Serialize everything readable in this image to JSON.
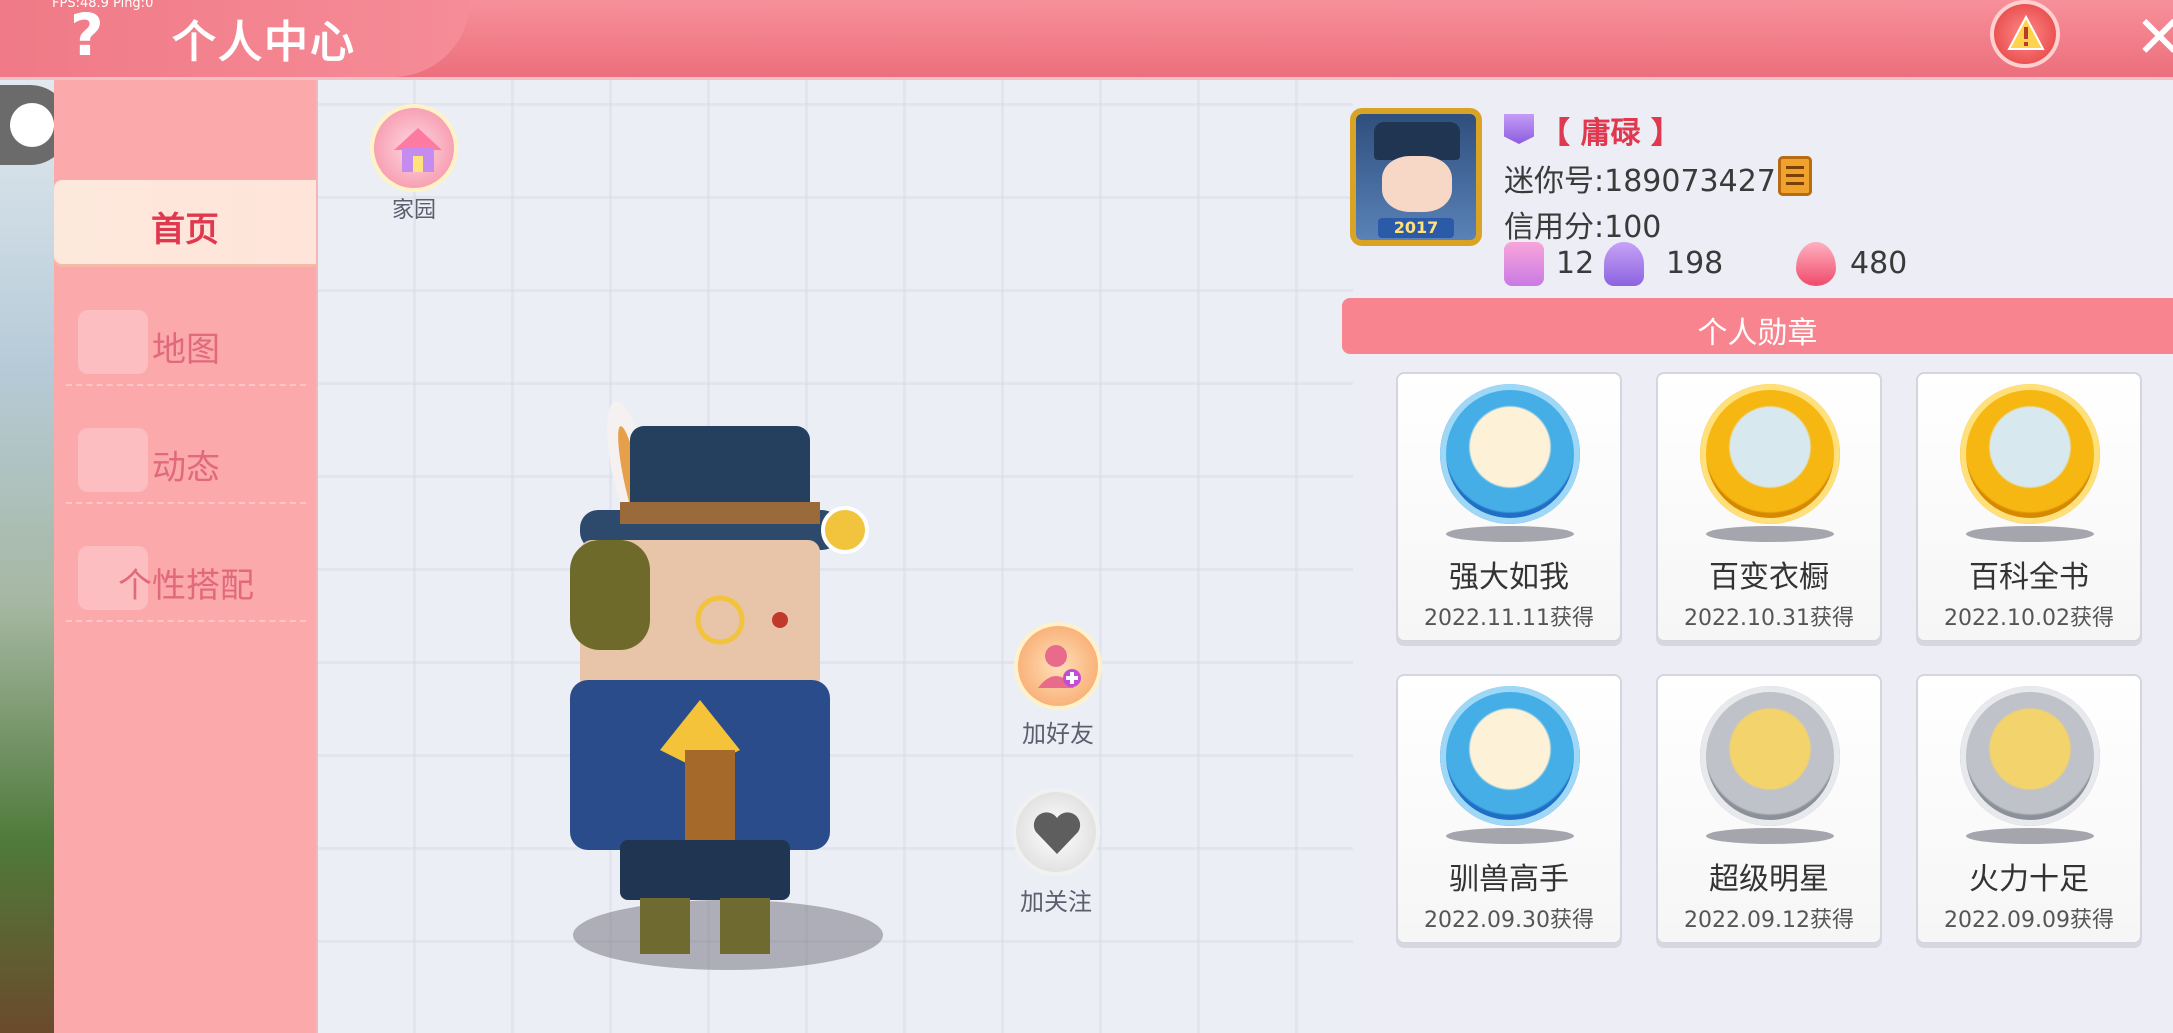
{
  "header": {
    "fps": "FPS:48.9 Ping:0",
    "help_label": "?",
    "title": "个人中心",
    "close_label": "✕",
    "warning_icon": "warning-icon"
  },
  "sidebar": {
    "items": [
      {
        "label": "首页",
        "active": true
      },
      {
        "label": "地图",
        "active": false
      },
      {
        "label": "动态",
        "active": false
      },
      {
        "label": "个性搭配",
        "active": false
      }
    ]
  },
  "main": {
    "home_label": "家园",
    "add_friend_label": "加好友",
    "follow_label": "加关注"
  },
  "profile": {
    "portrait_year": "2017",
    "nickname": "【 庸碌 】",
    "mini_id": "迷你号:189073427",
    "credit": "信用分:100",
    "stats": [
      "12",
      "198",
      "480"
    ]
  },
  "medals": {
    "header": "个人勋章",
    "items": [
      {
        "name": "强大如我",
        "date": "2022.11.11获得",
        "tier": "blue"
      },
      {
        "name": "百变衣橱",
        "date": "2022.10.31获得",
        "tier": "gold"
      },
      {
        "name": "百科全书",
        "date": "2022.10.02获得",
        "tier": "gold"
      },
      {
        "name": "驯兽高手",
        "date": "2022.09.30获得",
        "tier": "blue"
      },
      {
        "name": "超级明星",
        "date": "2022.09.12获得",
        "tier": "silver"
      },
      {
        "name": "火力十足",
        "date": "2022.09.09获得",
        "tier": "silver"
      }
    ]
  }
}
